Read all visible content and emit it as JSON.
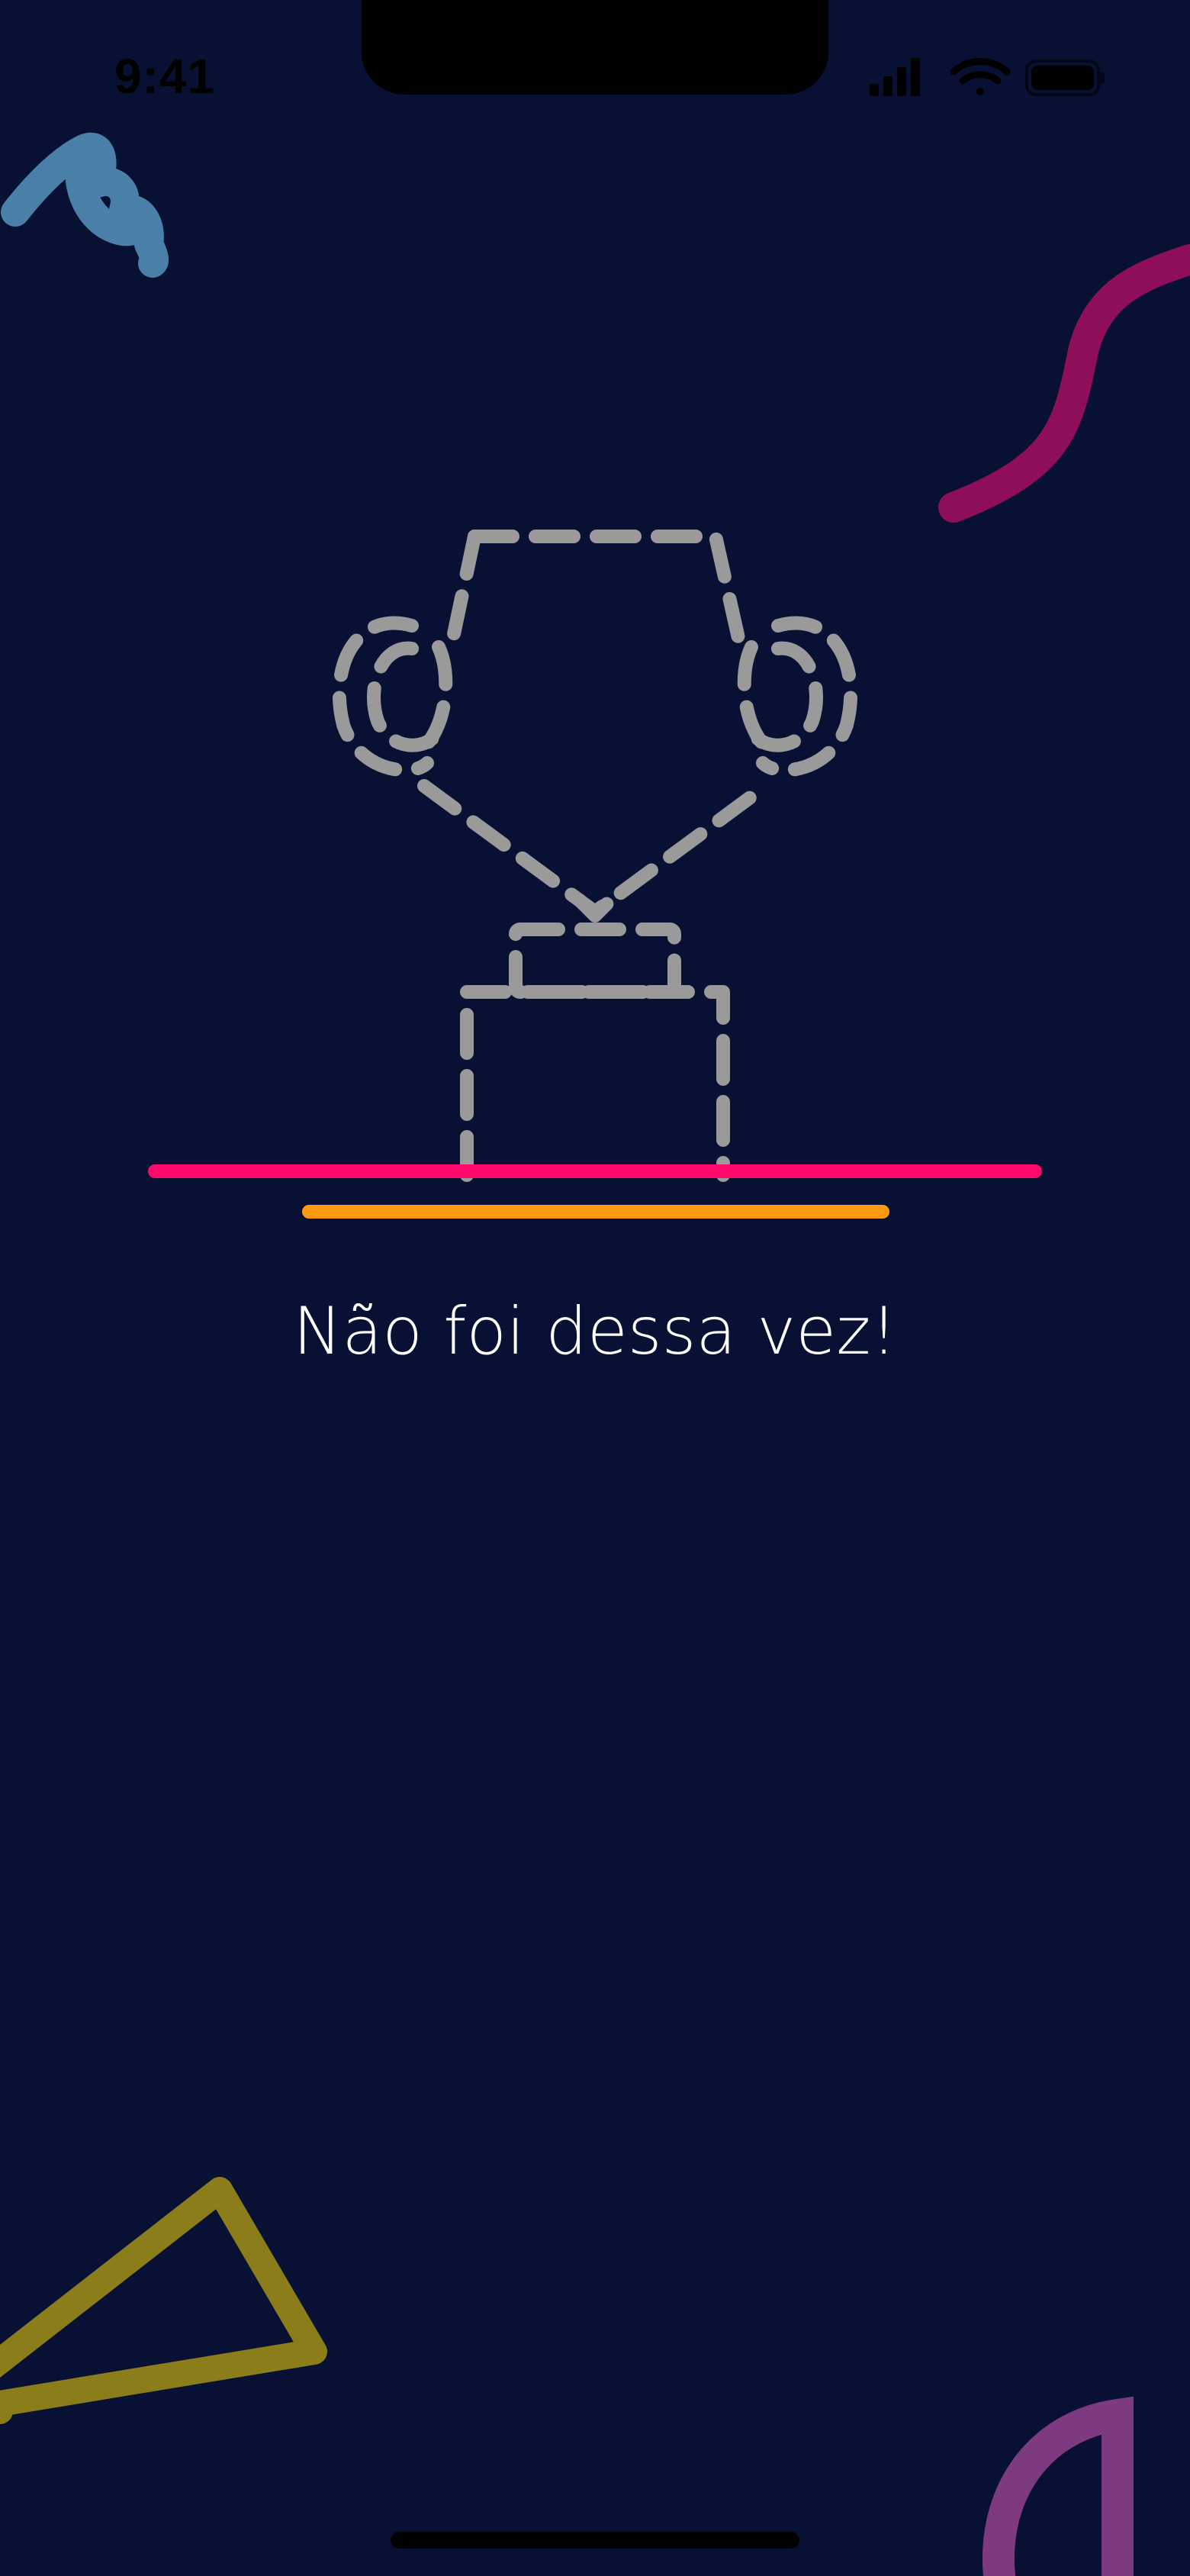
{
  "status_bar": {
    "time": "9:41",
    "icons": [
      "cellular-signal-icon",
      "wifi-icon",
      "battery-icon"
    ]
  },
  "result": {
    "message": "Não foi dessa vez!",
    "illustration": "trophy-outline-icon"
  },
  "colors": {
    "background": "#081034",
    "trophy_stroke": "#9a9a9a",
    "pink_line": "#ff0a6c",
    "orange_line": "#ff9a10",
    "blob_blue": "#4a7fa8",
    "squiggle_magenta": "#8e0e5a",
    "triangle_olive": "#8a7d1a",
    "arc_purple": "#7e3a80"
  }
}
